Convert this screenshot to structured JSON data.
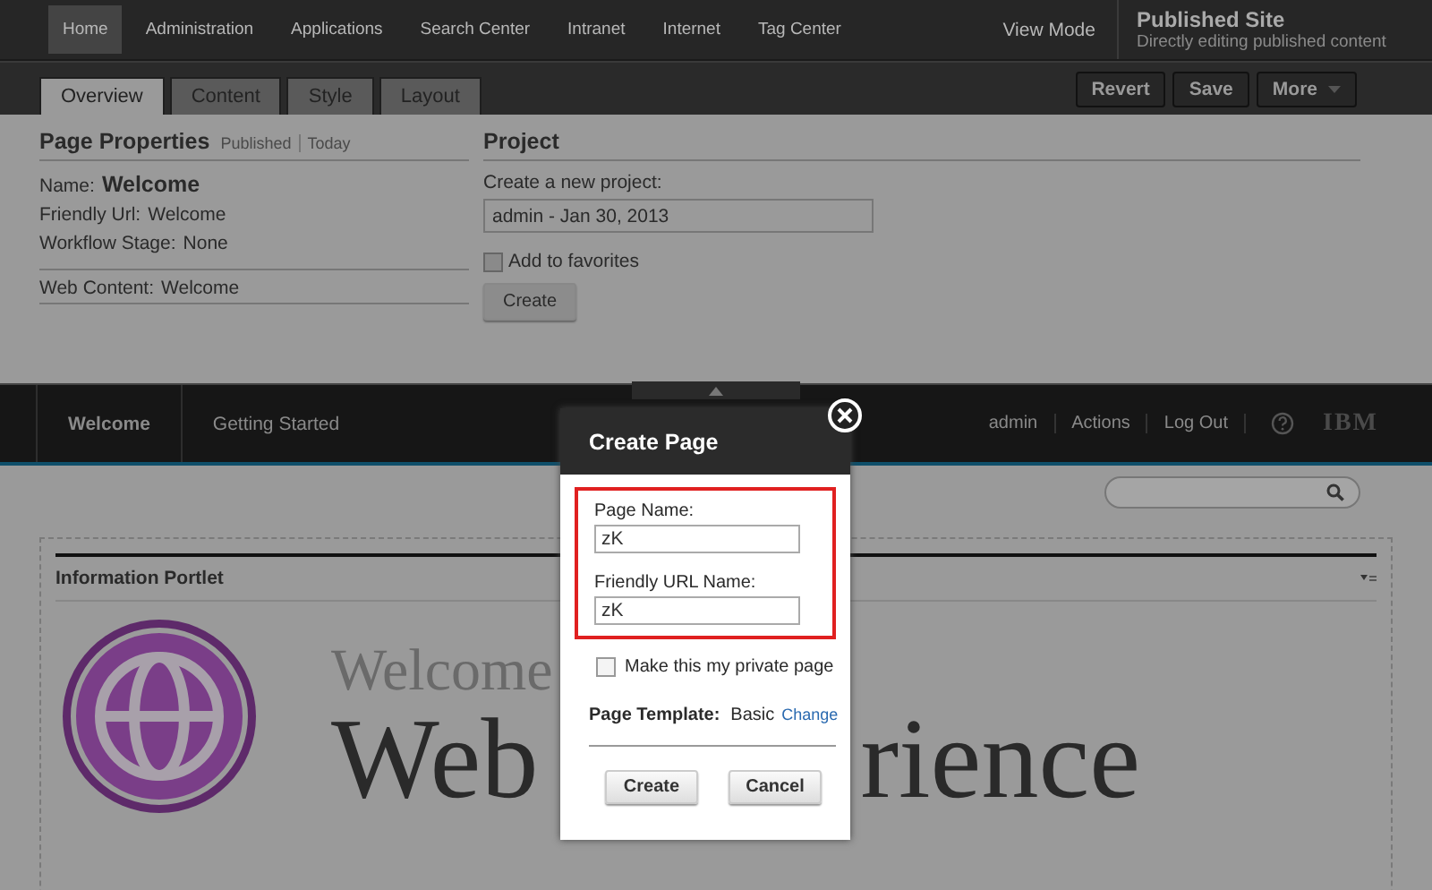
{
  "top_nav": {
    "items": [
      {
        "label": "Home",
        "selected": true
      },
      {
        "label": "Administration",
        "selected": false
      },
      {
        "label": "Applications",
        "selected": false
      },
      {
        "label": "Search Center",
        "selected": false
      },
      {
        "label": "Intranet",
        "selected": false
      },
      {
        "label": "Internet",
        "selected": false
      },
      {
        "label": "Tag Center",
        "selected": false
      }
    ],
    "view_mode": "View Mode",
    "site_title": "Published Site",
    "site_subtitle": "Directly editing published content"
  },
  "tabs": [
    {
      "label": "Overview",
      "selected": true
    },
    {
      "label": "Content",
      "selected": false
    },
    {
      "label": "Style",
      "selected": false
    },
    {
      "label": "Layout",
      "selected": false
    }
  ],
  "actions": [
    {
      "label": "Revert",
      "kind": "button"
    },
    {
      "label": "Save",
      "kind": "button"
    },
    {
      "label": "More",
      "kind": "menu"
    }
  ],
  "page_properties": {
    "title": "Page Properties",
    "meta": [
      "Published",
      "Today"
    ],
    "name_label": "Name:",
    "name": "Welcome",
    "fields": [
      {
        "label": "Friendly Url:",
        "value": "Welcome"
      },
      {
        "label": "Workflow Stage:",
        "value": "None"
      }
    ],
    "web_content": {
      "label": "Web Content:",
      "value": "Welcome"
    }
  },
  "project": {
    "title": "Project",
    "prompt": "Create a new project:",
    "value": "admin - Jan 30, 2013",
    "favorite_label": "Add to favorites",
    "favorite_checked": false,
    "button": "Create"
  },
  "site_nav": {
    "items": [
      {
        "label": "Welcome",
        "selected": true
      },
      {
        "label": "Getting Started",
        "selected": false
      }
    ],
    "links": [
      "admin",
      "Actions",
      "Log Out"
    ],
    "logo": "IBM"
  },
  "portlet": {
    "title": "Information Portlet",
    "heading_small": "Welcome",
    "heading_large_start": "Web",
    "heading_large_end": "rience"
  },
  "dialog": {
    "title": "Create Page",
    "fields": [
      {
        "label": "Page Name:",
        "value": "zK"
      },
      {
        "label": "Friendly URL Name:",
        "value": "zK"
      }
    ],
    "private_label": "Make this my private page",
    "private_checked": false,
    "template_label": "Page Template:",
    "template_value": "Basic",
    "template_link": "Change",
    "buttons": [
      "Create",
      "Cancel"
    ]
  }
}
